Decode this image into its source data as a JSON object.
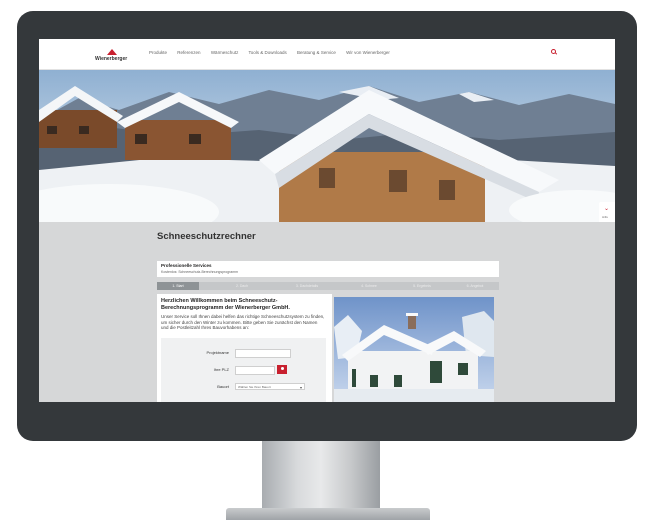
{
  "topnav": {
    "brand": "Wienerberger",
    "items": [
      "Produkte",
      "Referenzen",
      "Wärmeschutz",
      "Tools & Downloads",
      "Beratung & Service",
      "Wir von Wienerberger"
    ]
  },
  "sidetab": {
    "label": "Hilfe"
  },
  "page": {
    "title": "Schneeschutzrechner"
  },
  "service": {
    "heading": "Professionelle Services",
    "subheading": "Kostenlos: Schneeschutz-Berechnungsprogramm"
  },
  "steps": [
    "1. Start",
    "2. Dach",
    "3. Dachdetails",
    "4. Schnee",
    "5. Ergebnis",
    "6. Angebot"
  ],
  "welcome": {
    "heading": "Herzlichen Willkommen beim Schneeschutz-Berechnungsprogramm der Wienerberger GmbH.",
    "text": "Unser Service soll Ihnen dabei helfen das richtige Schneeschutzsystem zu finden, um sicher durch den Winter zu kommen. Bitte geben Sie zunächst den Namen und die Postleitzahl Ihres Bauvorhabens an:"
  },
  "form": {
    "project_label": "Projektname",
    "zip_label": "Ihre PLZ",
    "location_label": "Bauort",
    "location_value": "Wählen Sie Ihren Bauort"
  },
  "colors": {
    "accent": "#c8202f",
    "bezel": "#34383b",
    "page_bg": "#d6d7d8"
  }
}
